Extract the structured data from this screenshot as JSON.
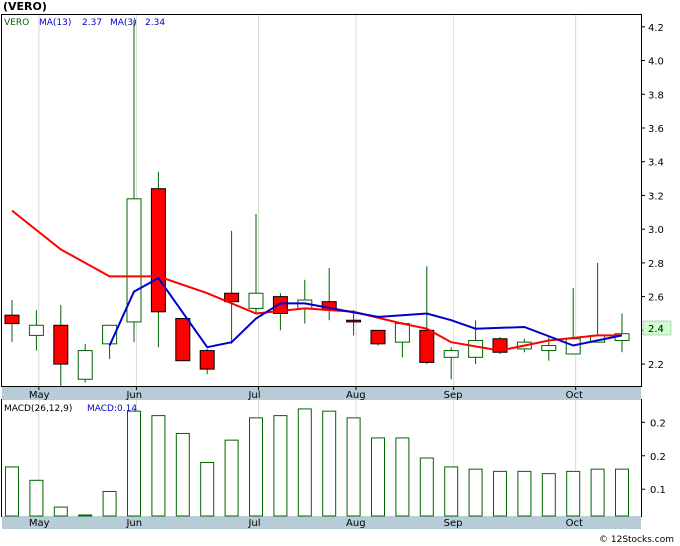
{
  "title": "(VERO)",
  "credit": "© 12Stocks.com",
  "colors": {
    "background": "#ffffff",
    "bear_candle": "#ff0000",
    "bull_candle": "#ffffff",
    "candle_outline": "#006400",
    "ma_long": "#ff0000",
    "ma_short": "#0000cc",
    "macd_bar": "#006400",
    "axis_band": "#b8ccd8",
    "last_price_bg": "#ccffcc"
  },
  "chart_data": [
    {
      "type": "candlestick",
      "legend": {
        "ticker": "VERO",
        "ma_long_label": "MA(13)",
        "ma_long_value": "2.37",
        "ma_short_label": "MA(3)",
        "ma_short_value": "2.34"
      },
      "last_price": "2.4",
      "ylim": [
        2.07,
        4.27
      ],
      "yticks": [
        "2.2",
        "2.4",
        "2.6",
        "2.8",
        "3.0",
        "3.2",
        "3.4",
        "3.6",
        "3.8",
        "4.0",
        "4.2"
      ],
      "months": [
        {
          "label": "May",
          "x_index": 1.1
        },
        {
          "label": "Jun",
          "x_index": 5.1
        },
        {
          "label": "Jul",
          "x_index": 10.1
        },
        {
          "label": "Aug",
          "x_index": 14.1
        },
        {
          "label": "Sep",
          "x_index": 18.1
        },
        {
          "label": "Oct",
          "x_index": 23.1
        }
      ],
      "candles": [
        {
          "o": 2.49,
          "h": 2.58,
          "l": 2.33,
          "c": 2.44
        },
        {
          "o": 2.37,
          "h": 2.52,
          "l": 2.28,
          "c": 2.43
        },
        {
          "o": 2.43,
          "h": 2.55,
          "l": 2.07,
          "c": 2.2
        },
        {
          "o": 2.11,
          "h": 2.32,
          "l": 2.09,
          "c": 2.28
        },
        {
          "o": 2.32,
          "h": 2.43,
          "l": 2.23,
          "c": 2.43
        },
        {
          "o": 2.45,
          "h": 4.24,
          "l": 2.33,
          "c": 3.18
        },
        {
          "o": 3.24,
          "h": 3.34,
          "l": 2.3,
          "c": 2.51
        },
        {
          "o": 2.47,
          "h": 2.47,
          "l": 2.22,
          "c": 2.22
        },
        {
          "o": 2.28,
          "h": 2.29,
          "l": 2.14,
          "c": 2.17
        },
        {
          "o": 2.62,
          "h": 2.99,
          "l": 2.32,
          "c": 2.57
        },
        {
          "o": 2.53,
          "h": 3.09,
          "l": 2.5,
          "c": 2.62
        },
        {
          "o": 2.6,
          "h": 2.62,
          "l": 2.4,
          "c": 2.5
        },
        {
          "o": 2.53,
          "h": 2.7,
          "l": 2.44,
          "c": 2.58
        },
        {
          "o": 2.57,
          "h": 2.77,
          "l": 2.46,
          "c": 2.52
        },
        {
          "o": 2.46,
          "h": 2.52,
          "l": 2.37,
          "c": 2.45
        },
        {
          "o": 2.4,
          "h": 2.4,
          "l": 2.31,
          "c": 2.32
        },
        {
          "o": 2.33,
          "h": 2.45,
          "l": 2.24,
          "c": 2.44
        },
        {
          "o": 2.4,
          "h": 2.78,
          "l": 2.2,
          "c": 2.21
        },
        {
          "o": 2.24,
          "h": 2.3,
          "l": 2.11,
          "c": 2.28
        },
        {
          "o": 2.24,
          "h": 2.46,
          "l": 2.2,
          "c": 2.34
        },
        {
          "o": 2.35,
          "h": 2.36,
          "l": 2.26,
          "c": 2.27
        },
        {
          "o": 2.29,
          "h": 2.35,
          "l": 2.27,
          "c": 2.33
        },
        {
          "o": 2.28,
          "h": 2.36,
          "l": 2.22,
          "c": 2.31
        },
        {
          "o": 2.26,
          "h": 2.65,
          "l": 2.26,
          "c": 2.35
        },
        {
          "o": 2.33,
          "h": 2.8,
          "l": 2.33,
          "c": 2.37
        },
        {
          "o": 2.34,
          "h": 2.5,
          "l": 2.27,
          "c": 2.38
        }
      ],
      "ma_long": [
        {
          "i": 0,
          "v": 3.11
        },
        {
          "i": 2,
          "v": 2.88
        },
        {
          "i": 4,
          "v": 2.72
        },
        {
          "i": 6,
          "v": 2.72
        },
        {
          "i": 8,
          "v": 2.62
        },
        {
          "i": 10,
          "v": 2.5
        },
        {
          "i": 12,
          "v": 2.53
        },
        {
          "i": 14,
          "v": 2.51
        },
        {
          "i": 16,
          "v": 2.44
        },
        {
          "i": 17,
          "v": 2.41
        },
        {
          "i": 18,
          "v": 2.33
        },
        {
          "i": 20,
          "v": 2.28
        },
        {
          "i": 22,
          "v": 2.34
        },
        {
          "i": 24,
          "v": 2.37
        },
        {
          "i": 25,
          "v": 2.37
        }
      ],
      "ma_short": [
        {
          "i": 4,
          "v": 2.31
        },
        {
          "i": 5,
          "v": 2.63
        },
        {
          "i": 6,
          "v": 2.71
        },
        {
          "i": 8,
          "v": 2.3
        },
        {
          "i": 9,
          "v": 2.33
        },
        {
          "i": 10,
          "v": 2.47
        },
        {
          "i": 11,
          "v": 2.56
        },
        {
          "i": 12,
          "v": 2.56
        },
        {
          "i": 15,
          "v": 2.48
        },
        {
          "i": 17,
          "v": 2.5
        },
        {
          "i": 18,
          "v": 2.46
        },
        {
          "i": 19,
          "v": 2.41
        },
        {
          "i": 21,
          "v": 2.42
        },
        {
          "i": 23,
          "v": 2.31
        },
        {
          "i": 25,
          "v": 2.37
        }
      ]
    },
    {
      "type": "bar",
      "legend": {
        "label": "MACD(26,12,9)",
        "value_label": "MACD:0.14"
      },
      "ylim": [
        0.02,
        0.28
      ],
      "yticks": [
        {
          "label": "0.1",
          "v": 0.08
        },
        {
          "label": "0.2",
          "v": 0.155
        },
        {
          "label": "0.2",
          "v": 0.23
        }
      ],
      "values": [
        0.13,
        0.1,
        0.04,
        0.0,
        0.075,
        0.255,
        0.245,
        0.205,
        0.14,
        0.19,
        0.24,
        0.245,
        0.26,
        0.255,
        0.24,
        0.195,
        0.195,
        0.15,
        0.13,
        0.125,
        0.12,
        0.12,
        0.115,
        0.12,
        0.125,
        0.125
      ]
    }
  ]
}
